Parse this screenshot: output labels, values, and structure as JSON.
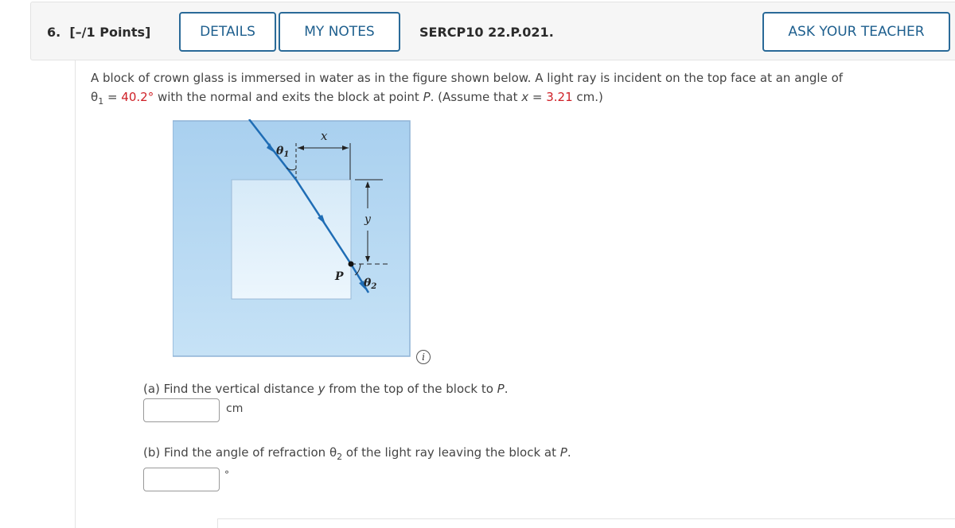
{
  "header": {
    "question_number": "6.",
    "points": "[–/1 Points]",
    "details_label": "DETAILS",
    "my_notes_label": "MY NOTES",
    "question_code": "SERCP10 22.P.021.",
    "ask_teacher_label": "ASK YOUR TEACHER"
  },
  "problem": {
    "text_1": "A block of crown glass is immersed in water as in the figure shown below. A light ray is incident on the top face at an angle of",
    "theta_symbol": "θ",
    "theta_sub": "1",
    "eq": " = ",
    "theta1_value": "40.2°",
    "text_2": " with the normal and exits the block at point ",
    "point": "P",
    "text_3": ". (Assume that ",
    "x_var": "x",
    "text_4": " = ",
    "x_value": "3.21",
    "text_5": " cm.)"
  },
  "figure": {
    "label_x": "x",
    "label_y": "y",
    "label_theta1": "θ",
    "label_theta1_sub": "1",
    "label_theta2": "θ",
    "label_theta2_sub": "2",
    "label_p": "P",
    "colors": {
      "water": "#aed3f0",
      "glass": "#e3f1fb",
      "ray": "#1f6db5"
    }
  },
  "info_icon_glyph": "i",
  "part_a": {
    "text_1": "(a) Find the vertical distance ",
    "var": "y",
    "text_2": " from the top of the block to ",
    "point": "P",
    "text_3": ".",
    "input_value": "",
    "unit": "cm"
  },
  "part_b": {
    "text_1": "(b) Find the angle of refraction ",
    "theta_symbol": "θ",
    "theta_sub": "2",
    "text_2": " of the light ray leaving the block at ",
    "point": "P",
    "text_3": ".",
    "input_value": "",
    "unit": "°"
  }
}
